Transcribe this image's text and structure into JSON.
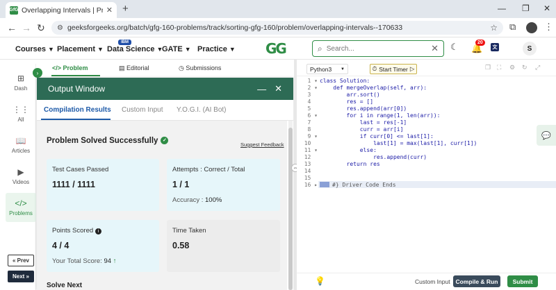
{
  "browser": {
    "tab_title": "Overlapping Intervals | Practice",
    "tab_favicon": "GfG",
    "url": "geeksforgeeks.org/batch/gfg-160-problems/track/sorting-gfg-160/problem/overlapping-intervals--170633"
  },
  "header": {
    "menus": [
      {
        "label": "Courses"
      },
      {
        "label": "Placement"
      },
      {
        "label": "Data Science"
      },
      {
        "label": "GATE"
      },
      {
        "label": "Practice"
      }
    ],
    "ibm_badge": "IBM",
    "logo": "GG",
    "search_placeholder": "Search...",
    "notification_count": "20",
    "avatar_initial": "S",
    "brand_color": "#2f8d46"
  },
  "rail": {
    "items": [
      {
        "label": "Dash",
        "icon": "dashboard-icon"
      },
      {
        "label": "All",
        "icon": "grid-icon"
      },
      {
        "label": "Articles",
        "icon": "book-icon"
      },
      {
        "label": "Videos",
        "icon": "video-icon"
      },
      {
        "label": "Problems",
        "icon": "code-icon"
      }
    ],
    "prev_label": "« Prev",
    "next_label": "Next »"
  },
  "problem_tabs": [
    {
      "label": "Problem"
    },
    {
      "label": "Editorial"
    },
    {
      "label": "Submissions"
    }
  ],
  "output": {
    "title": "Output Window",
    "tabs": [
      {
        "label": "Compilation Results"
      },
      {
        "label": "Custom Input"
      },
      {
        "label": "Y.O.G.I. (AI Bot)"
      }
    ],
    "status": "Problem Solved Successfully",
    "feedback": "Suggest Feedback",
    "cards": {
      "test_cases": {
        "label": "Test Cases Passed",
        "value": "1111 / 1111"
      },
      "attempts": {
        "label": "Attempts : Correct / Total",
        "value": "1 / 1",
        "sub_label": "Accuracy :",
        "sub_value": "100%"
      },
      "points": {
        "label": "Points Scored",
        "value": "4 / 4",
        "sub_label": "Your Total Score:",
        "sub_value": "94"
      },
      "time": {
        "label": "Time Taken",
        "value": "0.58"
      }
    },
    "solve_next": "Solve Next"
  },
  "editor": {
    "language": "Python3",
    "timer_label": "Start Timer",
    "line_numbers": [
      "1",
      "2",
      "3",
      "4",
      "5",
      "6",
      "7",
      "8",
      "9",
      "10",
      "11",
      "12",
      "13",
      "14",
      "15",
      "16"
    ],
    "code_lines": [
      "class Solution:",
      "    def mergeOverlap(self, arr):",
      "        arr.sort()",
      "        res = []",
      "        res.append(arr[0])",
      "        for i in range(1, len(arr)):",
      "            last = res[-1]",
      "            curr = arr[i]",
      "            if curr[0] <= last[1]:",
      "                last[1] = max(last[1], curr[1])",
      "            else:",
      "                res.append(curr)",
      "        return res",
      "",
      "",
      "#} Driver Code Ends"
    ],
    "custom_input": "Custom Input",
    "compile_run": "Compile & Run",
    "submit": "Submit"
  }
}
